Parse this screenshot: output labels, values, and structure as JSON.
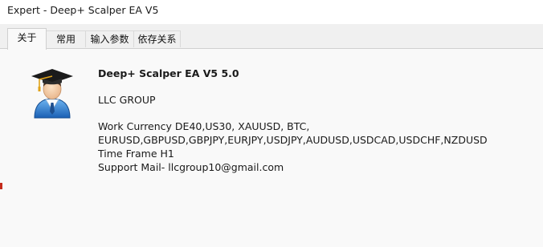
{
  "window": {
    "title": "Expert - Deep+ Scalper EA V5"
  },
  "tabs": [
    {
      "label": "关于",
      "active": true
    },
    {
      "label": "常用",
      "active": false
    },
    {
      "label": "输入参数",
      "active": false
    },
    {
      "label": "依存关系",
      "active": false
    }
  ],
  "about": {
    "icon": "graduate-avatar-icon",
    "name": "Deep+ Scalper EA V5 5.0",
    "company": "LLC GROUP",
    "description": [
      "Work Currency DE40,US30, XAUUSD, BTC,",
      "EURUSD,GBPUSD,GBPJPY,EURJPY,USDJPY,AUDUSD,USDCAD,USDCHF,NZDUSD",
      "Time Frame H1",
      "Support Mail- llcgroup10@gmail.com"
    ]
  },
  "colors": {
    "accent_blue": "#2f7fd3",
    "cap_black": "#1b1b1b",
    "tassel_gold": "#e0a21a"
  }
}
